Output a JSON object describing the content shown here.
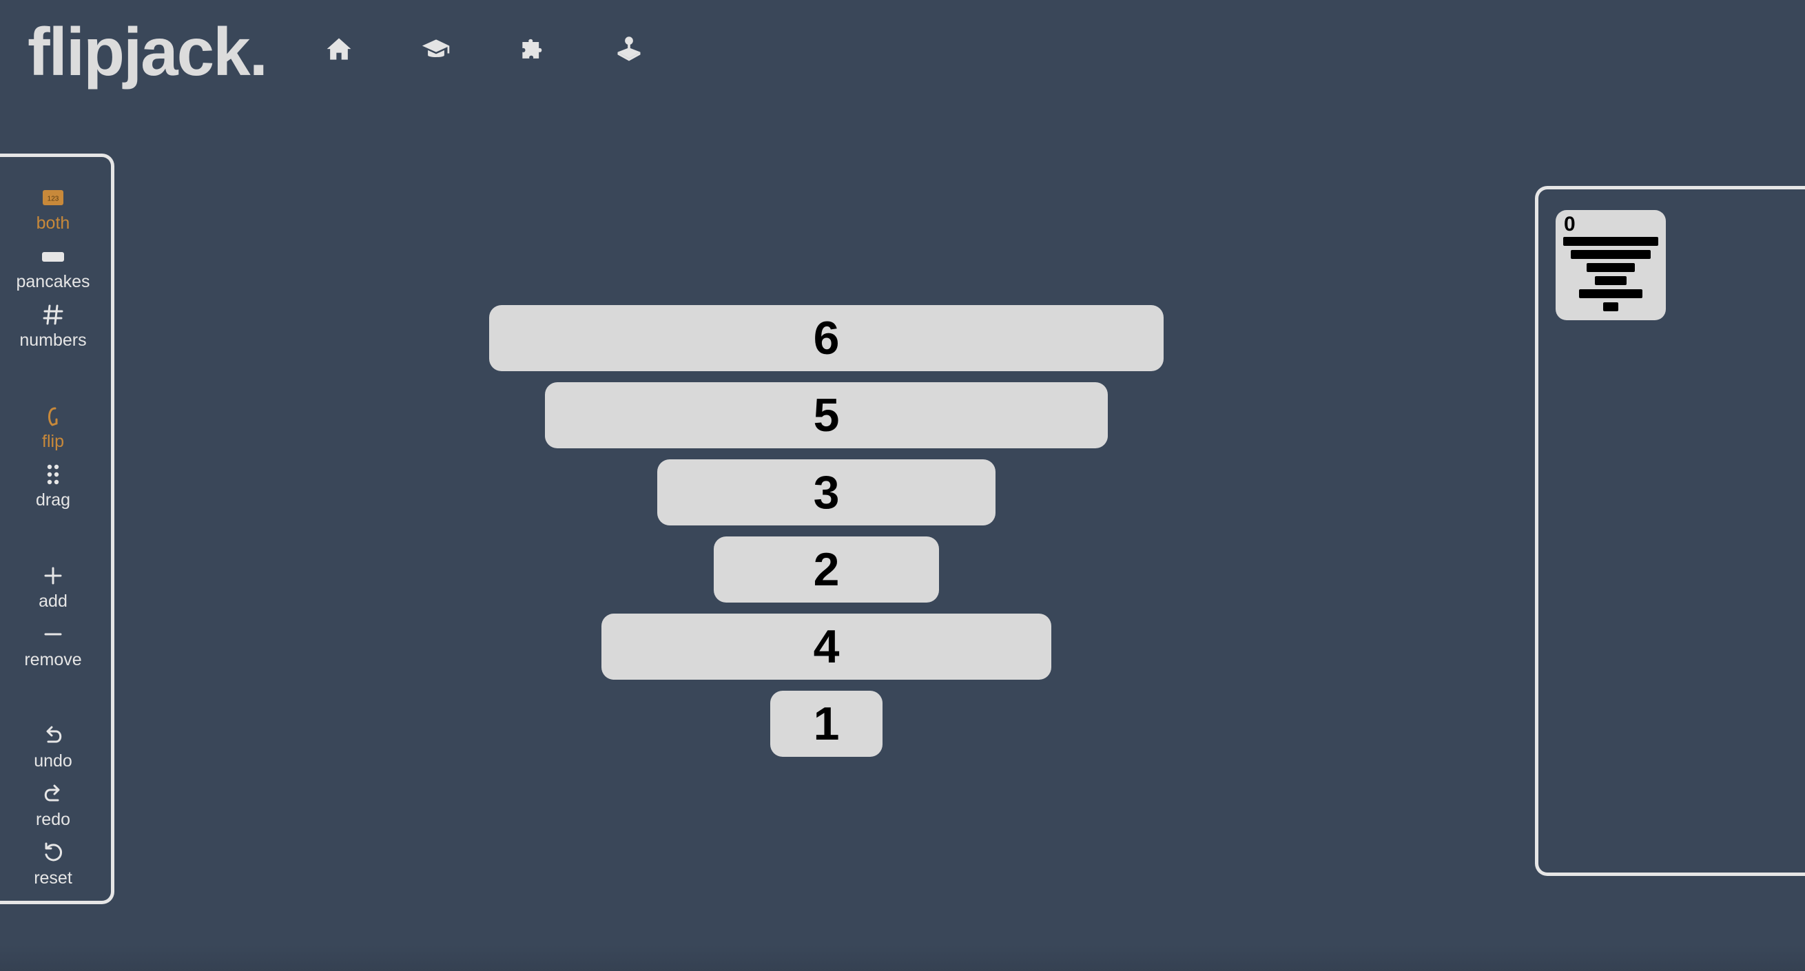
{
  "app": {
    "logo": "flipjack.",
    "background": "#3a4759",
    "accent": "#c8893a"
  },
  "nav": [
    {
      "icon": "home-icon"
    },
    {
      "icon": "graduation-cap-icon"
    },
    {
      "icon": "puzzle-icon"
    },
    {
      "icon": "joystick-icon"
    }
  ],
  "toolbar": {
    "display_group": [
      {
        "label": "both",
        "icon": "number-badge-icon",
        "active": true
      },
      {
        "label": "pancakes",
        "icon": "pancake-bar-icon",
        "active": false
      },
      {
        "label": "numbers",
        "icon": "hash-icon",
        "active": false
      }
    ],
    "mode_group": [
      {
        "label": "flip",
        "icon": "flip-icon",
        "active": true
      },
      {
        "label": "drag",
        "icon": "drag-handle-icon",
        "active": false
      }
    ],
    "size_group": [
      {
        "label": "add",
        "icon": "plus-icon"
      },
      {
        "label": "remove",
        "icon": "minus-icon"
      }
    ],
    "history_group": [
      {
        "label": "undo",
        "icon": "undo-icon"
      },
      {
        "label": "redo",
        "icon": "redo-icon"
      },
      {
        "label": "reset",
        "icon": "reset-icon"
      }
    ],
    "badge_text": "123"
  },
  "stack": {
    "pancakes": [
      {
        "value": 6,
        "label": "6"
      },
      {
        "value": 5,
        "label": "5"
      },
      {
        "value": 3,
        "label": "3"
      },
      {
        "value": 2,
        "label": "2"
      },
      {
        "value": 4,
        "label": "4"
      },
      {
        "value": 1,
        "label": "1"
      }
    ]
  },
  "history": {
    "entries": [
      {
        "flips": "0"
      }
    ]
  }
}
